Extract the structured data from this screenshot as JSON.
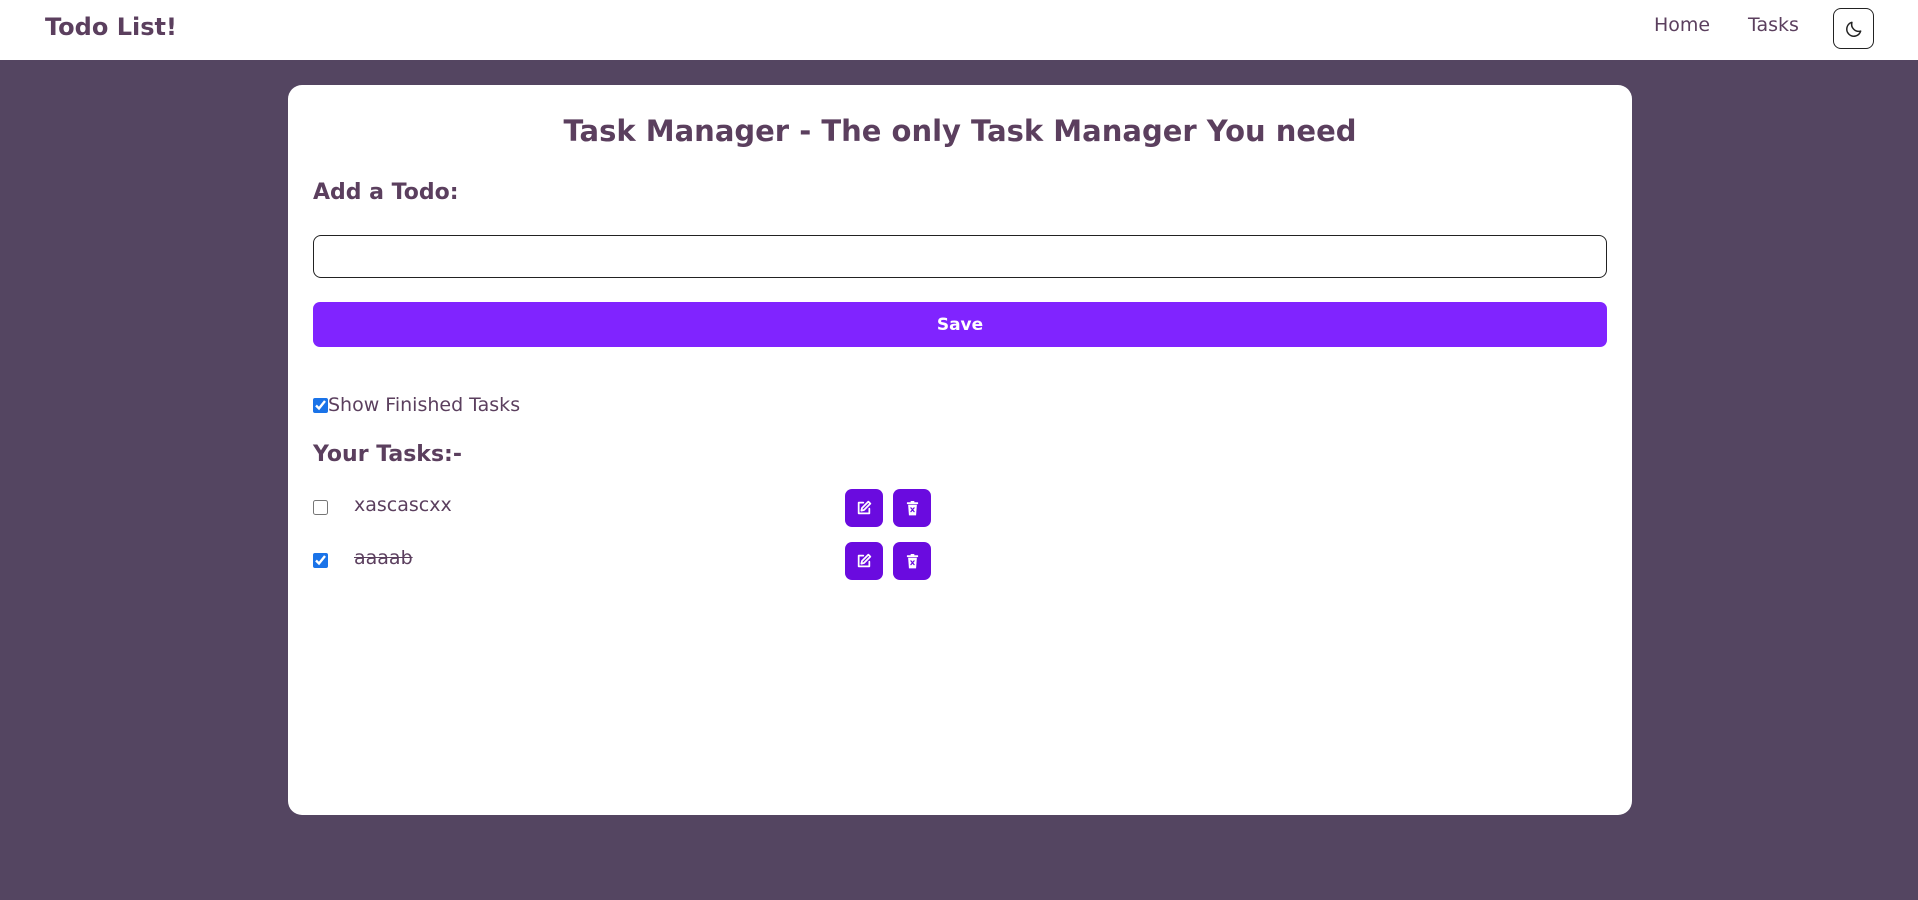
{
  "navbar": {
    "brand": "Todo List!",
    "links": [
      "Home",
      "Tasks"
    ],
    "theme_toggle_icon": "moon-icon"
  },
  "main": {
    "title": "Task Manager - The only Task Manager You need",
    "add_heading": "Add a Todo:",
    "input": {
      "value": "",
      "placeholder": ""
    },
    "save_label": "Save",
    "show_finished": {
      "label": "Show Finished Tasks",
      "checked": true
    },
    "tasks_heading": "Your Tasks:-",
    "tasks": [
      {
        "text": "xascascxx",
        "done": false
      },
      {
        "text": "aaaab",
        "done": true
      }
    ]
  },
  "colors": {
    "page_background": "#544561",
    "text": "#5b3f5e",
    "save_button": "#8024ff",
    "action_button": "#6a0bdf"
  },
  "icons": {
    "edit": "edit-icon",
    "delete": "trash-icon"
  }
}
